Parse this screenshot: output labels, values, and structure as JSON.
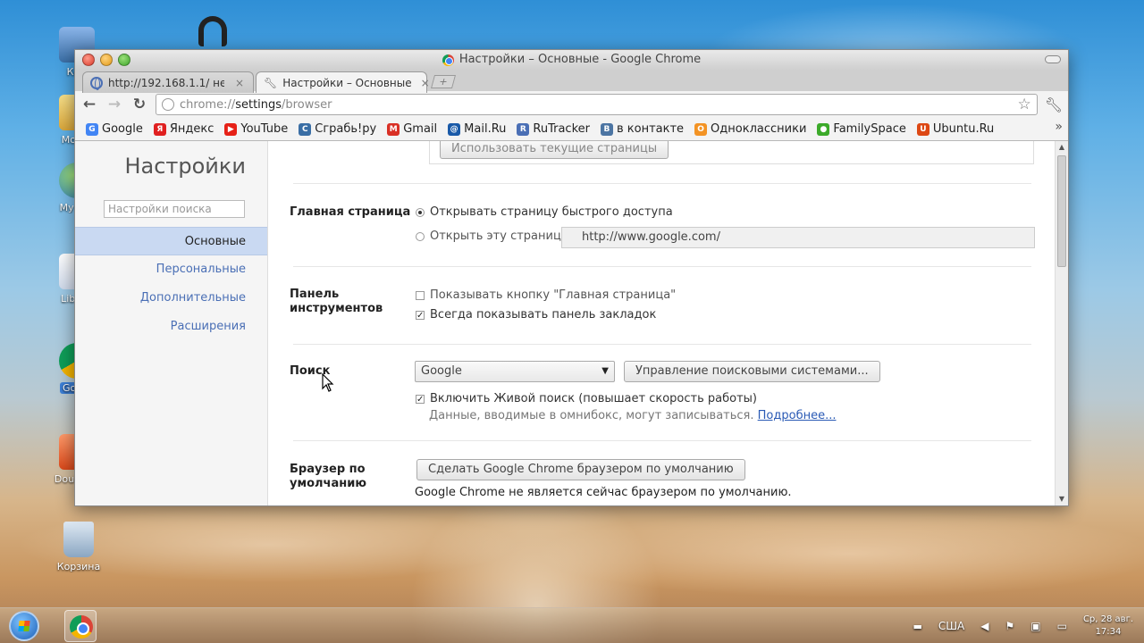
{
  "window": {
    "title": "Настройки – Основные - Google Chrome"
  },
  "tabs": [
    {
      "label": "http://192.168.1.1/ недост",
      "close": "×"
    },
    {
      "label": "Настройки – Основные",
      "close": "×"
    }
  ],
  "toolbar": {
    "url_scheme": "chrome://",
    "url_host": "settings",
    "url_path": "/browser"
  },
  "bookmarks": [
    {
      "label": "Google",
      "icon": "google-icon",
      "color": "#4285f4",
      "glyph": "G"
    },
    {
      "label": "Яндекс",
      "icon": "yandex-icon",
      "color": "#e02020",
      "glyph": "Я"
    },
    {
      "label": "YouTube",
      "icon": "youtube-icon",
      "color": "#e62117",
      "glyph": "▶"
    },
    {
      "label": "Сграбь!ру",
      "icon": "sgrab-icon",
      "color": "#3a6ea5",
      "glyph": "C"
    },
    {
      "label": "Gmail",
      "icon": "gmail-icon",
      "color": "#d93025",
      "glyph": "M"
    },
    {
      "label": "Mail.Ru",
      "icon": "mailru-icon",
      "color": "#1a5aa8",
      "glyph": "@"
    },
    {
      "label": "RuTracker",
      "icon": "rutracker-icon",
      "color": "#4a6fb5",
      "glyph": "R"
    },
    {
      "label": "в контакте",
      "icon": "vk-icon",
      "color": "#4c75a3",
      "glyph": "B"
    },
    {
      "label": "Одноклассники",
      "icon": "odnoklassniki-icon",
      "color": "#f39324",
      "glyph": "О"
    },
    {
      "label": "FamilySpace",
      "icon": "familyspace-icon",
      "color": "#3caa2a",
      "glyph": "●"
    },
    {
      "label": "Ubuntu.Ru",
      "icon": "ubuntu-icon",
      "color": "#dd4814",
      "glyph": "U"
    }
  ],
  "sidebar": {
    "title": "Настройки",
    "search_placeholder": "Настройки поиска",
    "items": [
      "Основные",
      "Персональные",
      "Дополнительные",
      "Расширения"
    ]
  },
  "settings": {
    "use_current_pages": "Использовать текущие страницы",
    "homepage": {
      "label": "Главная страница",
      "option_ntp": "Открывать страницу быстрого доступа",
      "option_url": "Открыть эту страницу:",
      "url_value": "http://www.google.com/"
    },
    "toolbar_section": {
      "label_line1": "Панель",
      "label_line2": "инструментов",
      "show_home_button": "Показывать кнопку \"Главная страница\"",
      "always_show_bookmarks": "Всегда показывать панель закладок"
    },
    "search": {
      "label": "Поиск",
      "engine": "Google",
      "manage_button": "Управление поисковыми системами...",
      "instant": "Включить Живой поиск (повышает скорость работы)",
      "hint": "Данные, вводимые в омнибокс, могут записываться.",
      "more_link": "Подробнее..."
    },
    "default_browser": {
      "label_line1": "Браузер по",
      "label_line2": "умолчанию",
      "button": "Сделать Google Chrome браузером по умолчанию",
      "status": "Google Chrome не является сейчас браузером по умолчанию."
    }
  },
  "desktop_icons": [
    "Ком",
    "Мои д",
    "My Net",
    "LibreO",
    "Googl",
    "Double C",
    "Корзина"
  ],
  "tray": {
    "layout": "США",
    "date": "Ср, 28 авг.",
    "time": "17:34"
  }
}
